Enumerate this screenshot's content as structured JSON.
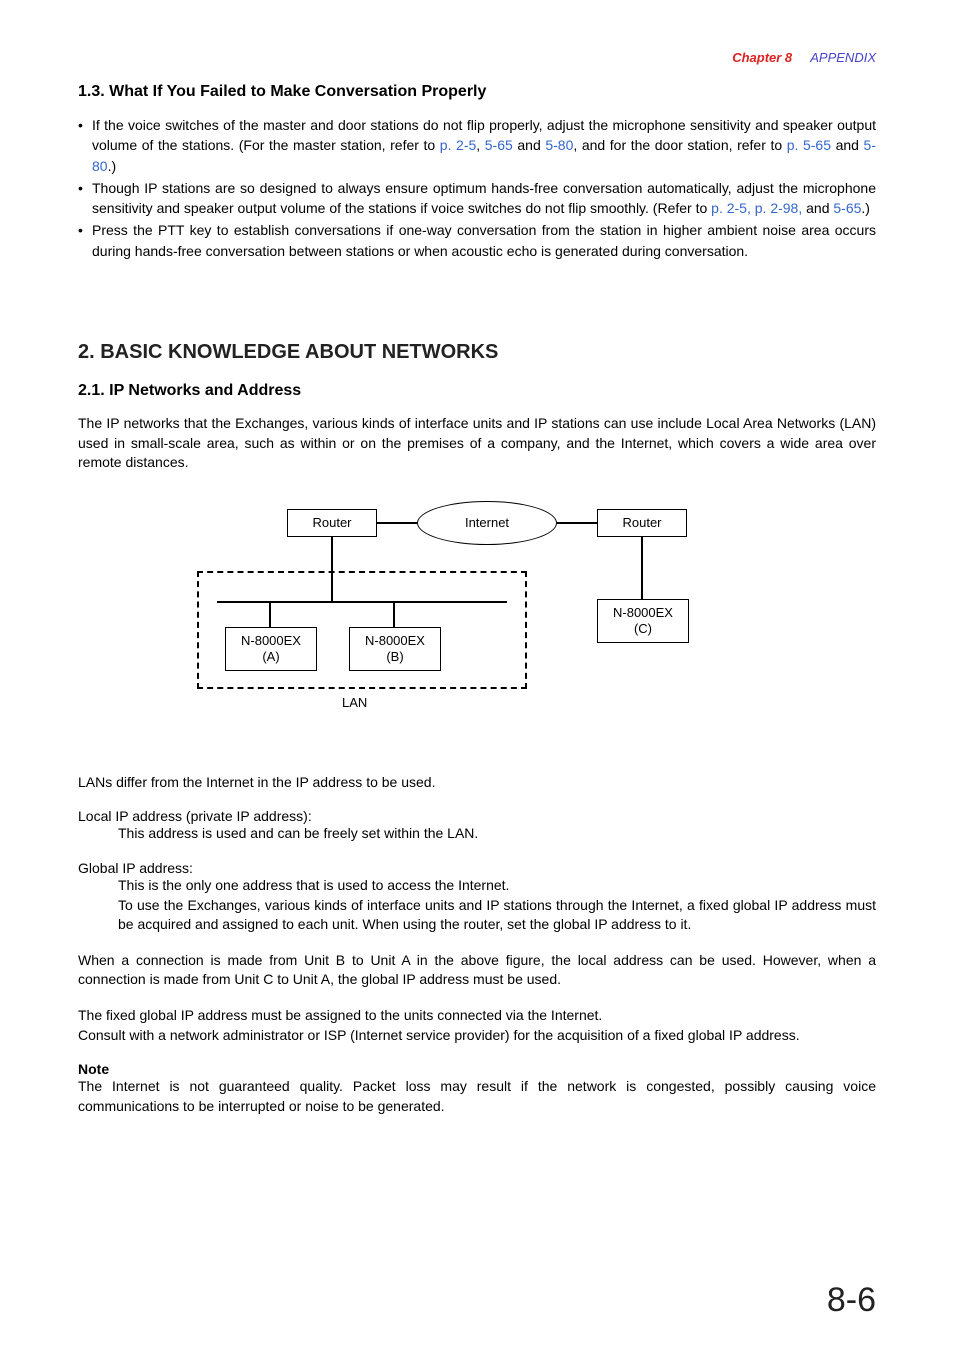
{
  "header": {
    "chapter": "Chapter 8",
    "section": "APPENDIX"
  },
  "s13": {
    "title": "1.3. What If You Failed to Make Conversation Properly",
    "b1a": "If the voice switches of the master and door stations do not flip properly, adjust the microphone sensitivity and speaker output volume of the stations. (For the master station, refer to ",
    "b1_l1": "p. 2-5",
    "b1b": ", ",
    "b1_l2": "5-65",
    "b1c": " and ",
    "b1_l3": "5-80",
    "b1d": ", and for the door station, refer to ",
    "b1_l4": "p. 5-65",
    "b1e": " and ",
    "b1_l5": "5-80",
    "b1f": ".)",
    "b2a": "Though IP stations are so designed to always ensure optimum hands-free conversation automatically, adjust the microphone sensitivity and speaker output volume of the stations if voice switches do not flip smoothly. (Refer to ",
    "b2_l1": "p. 2-5,",
    "b2b": " ",
    "b2_l2": "p. 2-98,",
    "b2c": " and ",
    "b2_l3": "5-65",
    "b2d": ".)",
    "b3": "Press the PTT key to establish conversations if one-way conversation from the station in higher ambient noise area occurs during hands-free conversation between stations or when acoustic echo is generated during conversation."
  },
  "s2": {
    "title": "2. BASIC KNOWLEDGE ABOUT NETWORKS",
    "s21_title": "2.1. IP Networks and Address",
    "intro": "The IP networks that the Exchanges, various kinds of interface units and IP stations can use include Local Area Networks (LAN) used in small-scale area, such as within or on the premises of a company, and the Internet, which covers a wide area over remote distances."
  },
  "diagram": {
    "router": "Router",
    "internet": "Internet",
    "nodeA1": "N-8000EX",
    "nodeA2": "(A)",
    "nodeB1": "N-8000EX",
    "nodeB2": "(B)",
    "nodeC1": "N-8000EX",
    "nodeC2": "(C)",
    "lan": "LAN"
  },
  "body": {
    "p_diff": "LANs differ from the Internet in the IP address to be used.",
    "local_term": "Local IP address (private IP address):",
    "local_desc": "This address is used and can be freely set within the LAN.",
    "global_term": "Global IP address:",
    "global_d1": "This is the only one address that is used to access the Internet.",
    "global_d2": "To use the Exchanges, various kinds of interface units and IP stations through the Internet, a fixed global IP address must be acquired and assigned to each unit. When using the router, set the global IP address to it.",
    "p_conn": "When a connection is made from Unit B to Unit A in the above figure, the local address can be used. However, when a connection is made from Unit C to Unit A, the global IP address must be used.",
    "p_fixed1": "The fixed global IP address must be assigned to the units connected via the Internet.",
    "p_fixed2": "Consult with a network administrator or ISP (Internet service provider) for the acquisition of a fixed global IP address.",
    "note_label": "Note",
    "note_text": "The Internet is not guaranteed quality. Packet loss may result if the network is congested, possibly causing voice communications to be interrupted or noise to be generated."
  },
  "page": "8-6"
}
